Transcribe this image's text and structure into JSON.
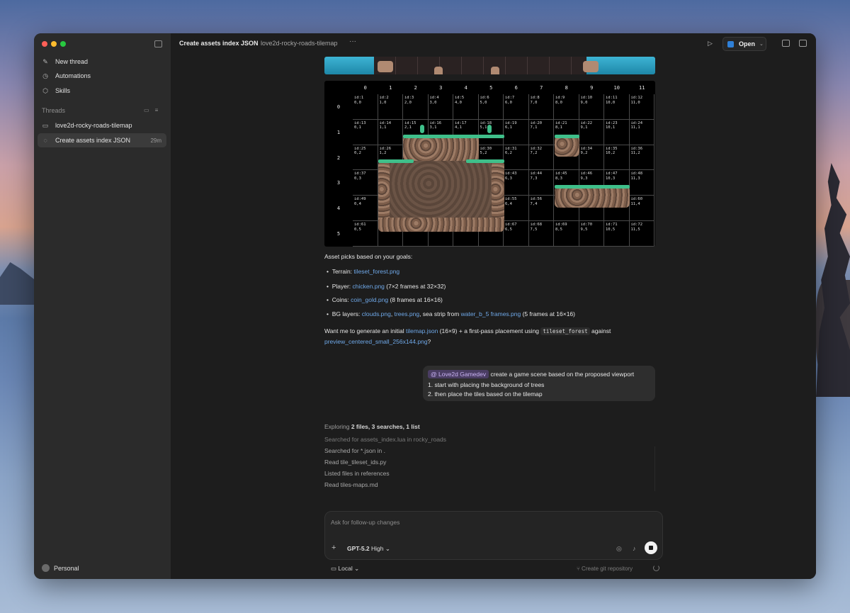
{
  "app": {
    "window_controls": {
      "close": "#ff5f57",
      "minimize": "#febc2e",
      "zoom": "#28c840"
    }
  },
  "sidebar": {
    "nav": [
      {
        "label": "New thread",
        "icon": "edit-icon"
      },
      {
        "label": "Automations",
        "icon": "clock-icon"
      },
      {
        "label": "Skills",
        "icon": "cube-icon"
      }
    ],
    "threads_label": "Threads",
    "threads": [
      {
        "label": "love2d-rocky-roads-tilemap",
        "icon": "folder-icon",
        "meta": ""
      },
      {
        "label": "Create assets index JSON",
        "icon": "spinner-icon",
        "meta": "29m"
      }
    ],
    "account": "Personal"
  },
  "header": {
    "title": "Create assets index JSON",
    "project": "love2d-rocky-roads-tilemap",
    "more": "···",
    "open_label": "Open"
  },
  "tilemap": {
    "columns": [
      "0",
      "1",
      "2",
      "3",
      "4",
      "5",
      "6",
      "7",
      "8",
      "9",
      "10",
      "11"
    ],
    "rows": [
      "0",
      "1",
      "2",
      "3",
      "4",
      "5"
    ],
    "grass_color": "#3fbf8a",
    "rock_color": "#9d7b65"
  },
  "assistant": {
    "intro": "Asset picks based on your goals:",
    "bullets": [
      {
        "label": "Terrain: ",
        "link": "tileset_forest.png",
        "rest": ""
      },
      {
        "label": "Player: ",
        "link": "chicken.png",
        "rest": " (7×2 frames at 32×32)"
      },
      {
        "label": "Coins: ",
        "link": "coin_gold.png",
        "rest": " (8 frames at 16×16)"
      },
      {
        "label": "BG layers: ",
        "link": "clouds.png",
        "sep1": ", ",
        "link2": "trees.png",
        "mid": ", sea strip from ",
        "link3": "water_b_5 frames.png",
        "rest": " (5 frames at 16×16)"
      }
    ],
    "question": {
      "p1": "Want me to generate an initial ",
      "link1": "tilemap.json",
      "p2": " (16×9) + a first-pass placement using ",
      "code": "tileset_forest",
      "p3": " against",
      "link2": "preview_centered_small_256x144.png",
      "p4": "?"
    }
  },
  "user_message": {
    "mention": "@ Love2d Gamedev",
    "line1": " create a game scene based on the proposed viewport",
    "line2": "1. start with placing the background of trees",
    "line3": "2. then place the tiles based on the tilemap"
  },
  "exploring": {
    "label": "Exploring ",
    "summary": "2 files, 3 searches, 1 list",
    "log": [
      "Searched for assets_index.lua in rocky_roads",
      "Searched for *.json in .",
      "Read tile_tileset_ids.py",
      "Listed files in references",
      "Read tiles-maps.md"
    ]
  },
  "composer": {
    "placeholder": "Ask for follow-up changes",
    "model": "GPT-5.2",
    "effort": "High",
    "environment": "Local",
    "create_repo": "Create git repository"
  }
}
